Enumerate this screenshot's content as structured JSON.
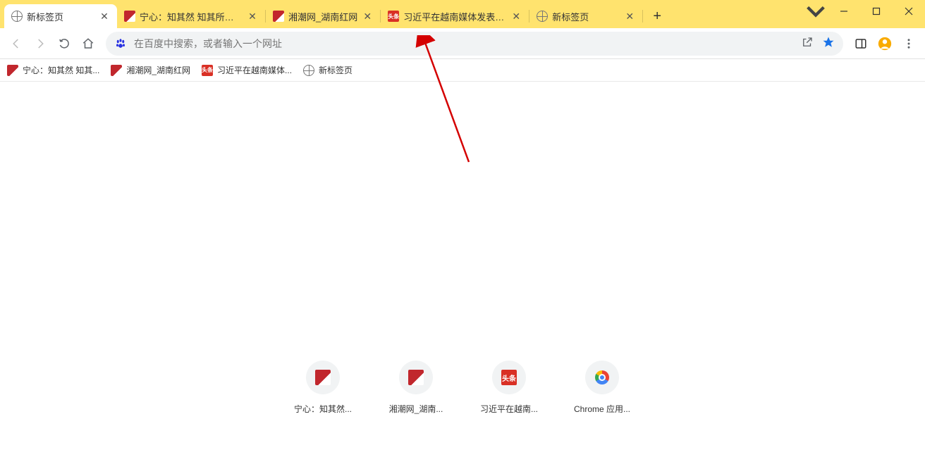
{
  "tabs": [
    {
      "title": "新标签页",
      "icon": "globe",
      "active": true
    },
    {
      "title": "宁心：知其然 知其所以然",
      "icon": "red-fav",
      "active": false
    },
    {
      "title": "湘潮网_湖南红网",
      "icon": "red-fav",
      "active": false
    },
    {
      "title": "习近平在越南媒体发表署名",
      "icon": "red-square",
      "active": false
    },
    {
      "title": "新标签页",
      "icon": "globe",
      "active": false
    }
  ],
  "omnibox": {
    "placeholder": "在百度中搜索，或者输入一个网址"
  },
  "bookmarks": [
    {
      "label": "宁心：知其然 知其...",
      "icon": "red-fav"
    },
    {
      "label": "湘潮网_湖南红网",
      "icon": "red-fav"
    },
    {
      "label": "习近平在越南媒体...",
      "icon": "red-square"
    },
    {
      "label": "新标签页",
      "icon": "globe"
    }
  ],
  "shortcuts": [
    {
      "label": "宁心：知其然...",
      "icon": "red-fav"
    },
    {
      "label": "湘潮网_湖南...",
      "icon": "red-fav"
    },
    {
      "label": "习近平在越南...",
      "icon": "red-square"
    },
    {
      "label": "Chrome 应用...",
      "icon": "chrome"
    }
  ],
  "red_square_text": "头条"
}
